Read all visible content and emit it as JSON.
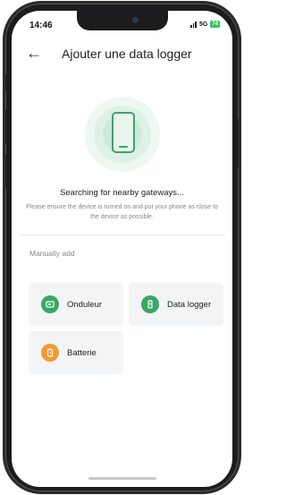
{
  "status_bar": {
    "time": "14:46",
    "network": "5G",
    "battery": "74"
  },
  "header": {
    "title": "Ajouter une data logger",
    "back_icon": "arrow-left-icon"
  },
  "search": {
    "status": "Searching for nearby gateways...",
    "hint": "Please ensure the device is turned on and put your phone as close to the device as possible."
  },
  "manual": {
    "label": "Manually add",
    "items": [
      {
        "label": "Onduleur",
        "icon": "inverter-icon",
        "color": "#39a766"
      },
      {
        "label": "Data logger",
        "icon": "data-logger-icon",
        "color": "#39a766"
      },
      {
        "label": "Batterie",
        "icon": "battery-icon",
        "color": "#f59a33"
      }
    ]
  },
  "colors": {
    "accent": "#39a766",
    "battery": "#f59a33"
  }
}
